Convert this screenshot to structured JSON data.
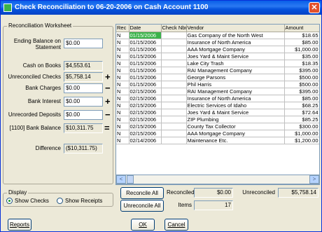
{
  "window": {
    "title": "Check Reconciliation to 06-20-2006 on Cash Account 1100",
    "close_glyph": "✕"
  },
  "worksheet": {
    "title": "Reconciliation Worksheet",
    "ending_balance_label": "Ending Balance on Statement",
    "ending_balance_value": "$0.00",
    "cash_on_books_label": "Cash on Books",
    "cash_on_books_value": "$4,553.61",
    "unreconciled_checks_label": "Unreconciled Checks",
    "unreconciled_checks_value": "$5,758.14",
    "bank_charges_label": "Bank Charges",
    "bank_charges_value": "$0.00",
    "bank_interest_label": "Bank Interest",
    "bank_interest_value": "$0.00",
    "unrecorded_deposits_label": "Unrecorded Deposits",
    "unrecorded_deposits_value": "$0.00",
    "bank_balance_label": "[1100] Bank Balance",
    "bank_balance_value": "$10,311.75",
    "difference_label": "Difference",
    "difference_value": "($10,311.75)",
    "ops": {
      "plus1": "+",
      "minus1": "−",
      "plus2": "+",
      "minus2": "−",
      "equals": "="
    }
  },
  "display": {
    "title": "Display",
    "show_checks": "Show Checks",
    "show_receipts": "Show Receipts",
    "selected": "show_checks"
  },
  "table": {
    "columns": [
      "Rec",
      "Date",
      "Check Nbr",
      "Vendor",
      "Amount"
    ],
    "rows": [
      {
        "rec": "N",
        "date": "01/15/2006",
        "check": "",
        "vendor": "Gas Company of the North West",
        "amount": "$18.65"
      },
      {
        "rec": "N",
        "date": "01/15/2006",
        "check": "",
        "vendor": "Insurance of North America",
        "amount": "$85.00"
      },
      {
        "rec": "N",
        "date": "01/15/2006",
        "check": "",
        "vendor": "AAA Mortgage Company",
        "amount": "$1,000.00"
      },
      {
        "rec": "N",
        "date": "01/15/2006",
        "check": "",
        "vendor": "Joes Yard & Maint Service",
        "amount": "$35.00"
      },
      {
        "rec": "N",
        "date": "01/15/2006",
        "check": "",
        "vendor": "Lake City Trash",
        "amount": "$18.35"
      },
      {
        "rec": "N",
        "date": "01/15/2006",
        "check": "",
        "vendor": "RAI Management Company",
        "amount": "$395.00"
      },
      {
        "rec": "N",
        "date": "01/15/2006",
        "check": "",
        "vendor": "George Parsons",
        "amount": "$500.00"
      },
      {
        "rec": "N",
        "date": "01/15/2006",
        "check": "",
        "vendor": "Phil Harris",
        "amount": "$500.00"
      },
      {
        "rec": "N",
        "date": "02/15/2006",
        "check": "",
        "vendor": "RAI Management Company",
        "amount": "$395.00"
      },
      {
        "rec": "N",
        "date": "02/15/2006",
        "check": "",
        "vendor": "Insurance of North America",
        "amount": "$85.00"
      },
      {
        "rec": "N",
        "date": "02/15/2006",
        "check": "",
        "vendor": "Electric Services of Idaho",
        "amount": "$68.25"
      },
      {
        "rec": "N",
        "date": "02/15/2006",
        "check": "",
        "vendor": "Joes Yard & Maint Service",
        "amount": "$72.64"
      },
      {
        "rec": "N",
        "date": "02/15/2006",
        "check": "",
        "vendor": "ZIP Plumbing",
        "amount": "$85.25"
      },
      {
        "rec": "N",
        "date": "02/15/2006",
        "check": "",
        "vendor": "County Tax Collector",
        "amount": "$300.00"
      },
      {
        "rec": "N",
        "date": "02/15/2006",
        "check": "",
        "vendor": "AAA Mortgage Company",
        "amount": "$1,000.00"
      },
      {
        "rec": "N",
        "date": "02/14/2006",
        "check": "",
        "vendor": "Maintenance Etc.",
        "amount": "$1,200.00"
      }
    ]
  },
  "scrollbar": {
    "left_glyph": "<",
    "right_glyph": ">"
  },
  "summary": {
    "reconcile_all": "Reconcile All",
    "unreconcile_all": "Unreconcile All",
    "reconciled_label": "Reconciled",
    "reconciled_value": "$0.00",
    "items_label": "Items",
    "items_value": "17",
    "unreconciled_label": "Unreconciled",
    "unreconciled_value": "$5,758.14"
  },
  "buttons": {
    "reports": "Reports",
    "ok": "OK",
    "cancel": "Cancel"
  },
  "colors": {
    "titlebar": "#0a5fe8",
    "selected_cell": "#3bb34a",
    "background": "#ece9d8"
  }
}
